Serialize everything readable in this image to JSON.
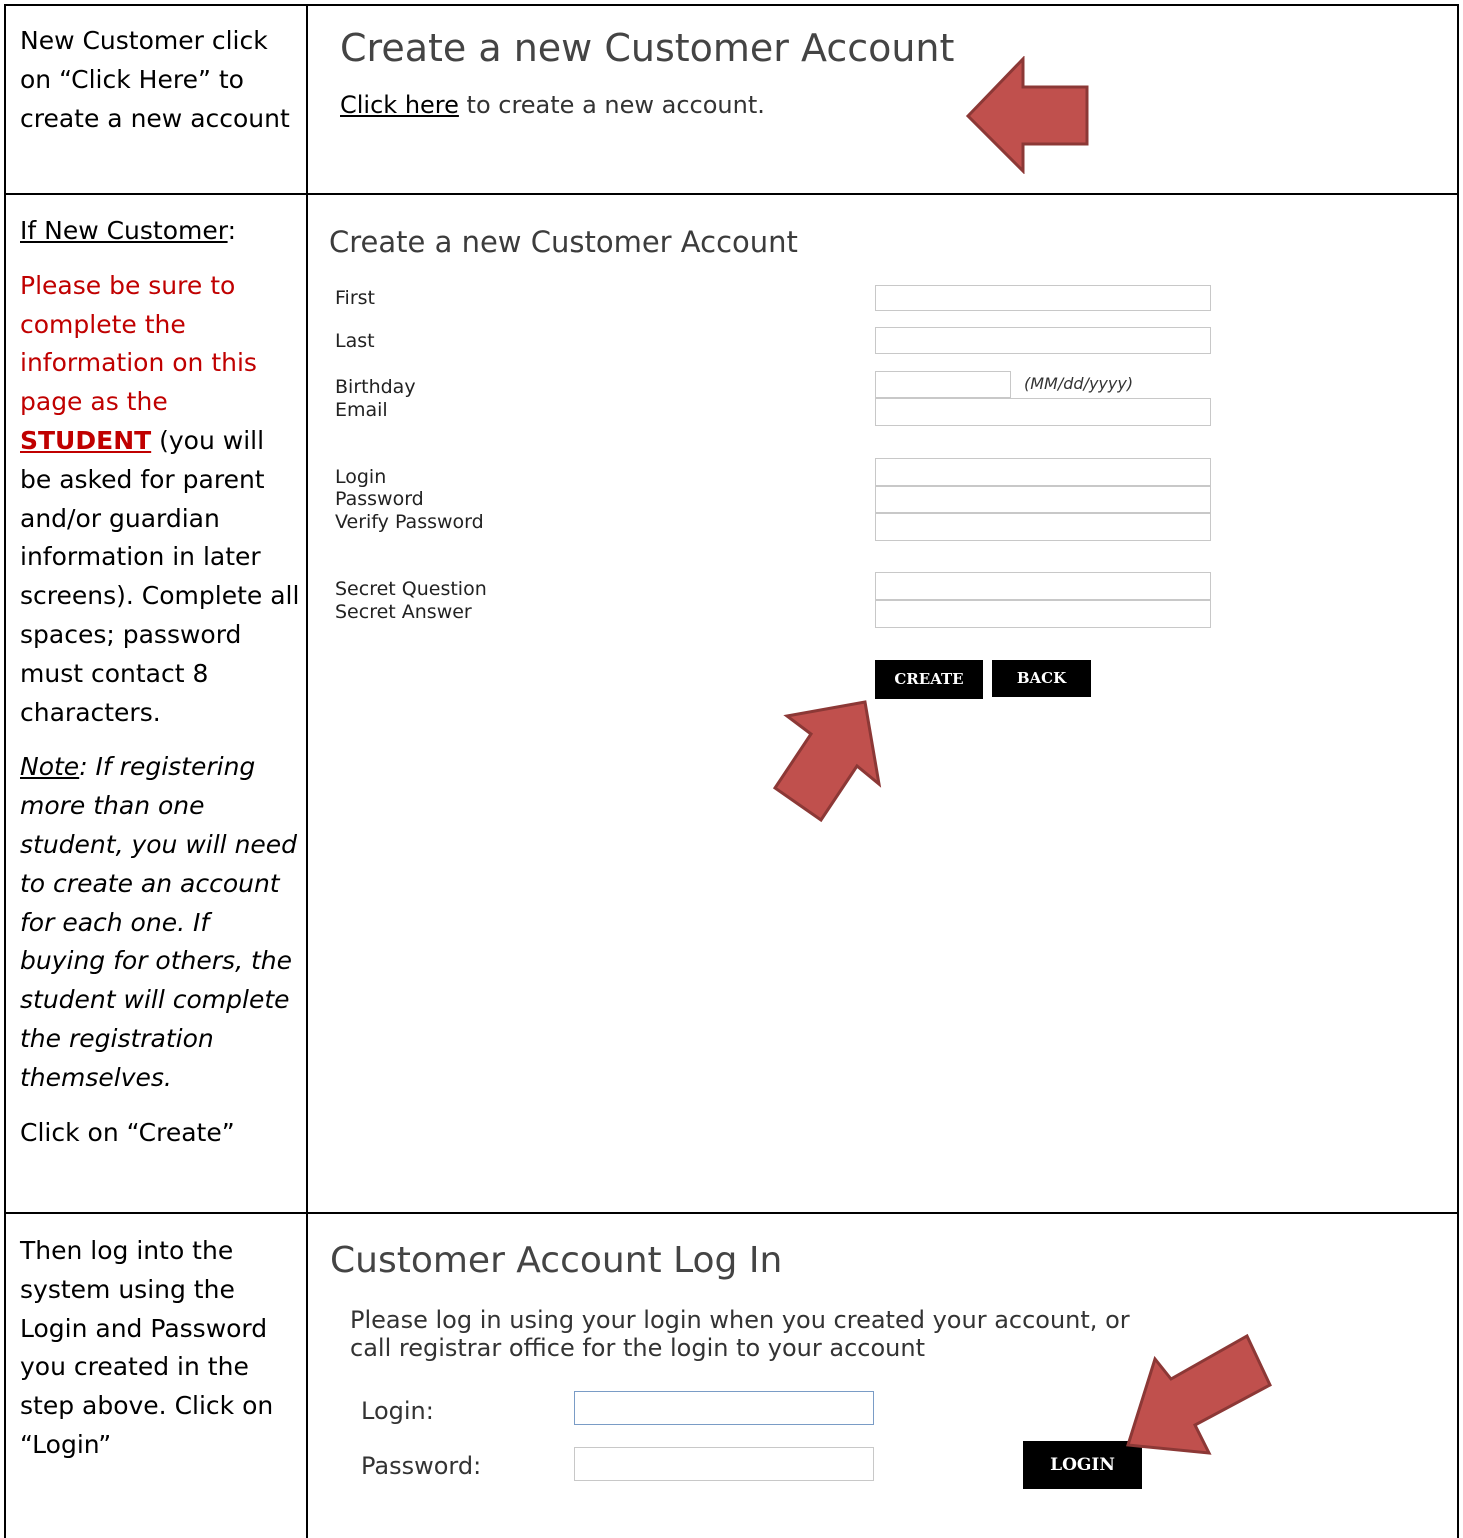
{
  "row1": {
    "instruction": "New Customer click on “Click Here” to create a new account",
    "title": "Create a new Customer Account",
    "link_text": "Click here",
    "link_suffix": " to create a new account."
  },
  "row2": {
    "heading": "If New Customer",
    "heading_colon": ":",
    "red_text": "Please be sure to complete the information on this page as the",
    "student_word": "STUDENT",
    "after_student": " (you will be asked for parent and/or guardian information in later screens).  Complete all spaces; password must contact 8 characters.",
    "note_label": "Note",
    "note_text": ":  If registering more than one student, you will need to create an account for each one.  If buying for others, the student will complete the registration themselves.",
    "final": "Click on “Create”",
    "form_title": "Create a new Customer Account",
    "labels": {
      "first": "First",
      "last": "Last",
      "birthday": "Birthday",
      "email": "Email",
      "login": "Login",
      "password": "Password",
      "verify": "Verify Password",
      "question": "Secret Question",
      "answer": "Secret Answer"
    },
    "birthday_hint": "(MM/dd/yyyy)",
    "create_button": "CREATE",
    "back_button": "BACK"
  },
  "row3": {
    "instruction": "Then log into the system using the Login and Password you created in the step above.  Click on “Login”",
    "title": "Customer Account Log In",
    "message_line1": "Please log in using your login when you created your account, or",
    "message_line2": "call registrar office for the login to your account",
    "login_label": "Login:",
    "password_label": "Password:",
    "login_button": "LOGIN"
  },
  "colors": {
    "arrow_fill": "#c0504d",
    "arrow_stroke": "#8c3836",
    "warning_red": "#c00000",
    "button_bg": "#000000"
  }
}
